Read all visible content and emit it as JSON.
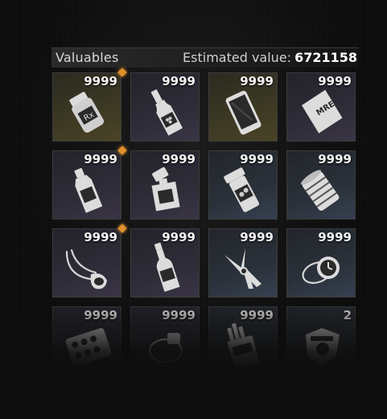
{
  "header": {
    "title": "Valuables",
    "estimate_label": "Estimated value:",
    "estimate_value": "6721158"
  },
  "slots": [
    {
      "count": "9999",
      "icon": "pill-bottle-rx-icon",
      "tint": "gold"
    },
    {
      "count": "9999",
      "icon": "wine-bottle-icon",
      "tint": "purple"
    },
    {
      "count": "9999",
      "icon": "smartphone-icon",
      "tint": "gold"
    },
    {
      "count": "9999",
      "icon": "mre-ration-icon",
      "tint": "purple"
    },
    {
      "count": "9999",
      "icon": "liquor-bottle-icon",
      "tint": "purple"
    },
    {
      "count": "9999",
      "icon": "perfume-bottle-icon",
      "tint": "purple"
    },
    {
      "count": "9999",
      "icon": "medicine-jar-icon",
      "tint": "blue"
    },
    {
      "count": "9999",
      "icon": "tin-can-icon",
      "tint": "blue"
    },
    {
      "count": "9999",
      "icon": "necklace-icon",
      "tint": "purple"
    },
    {
      "count": "9999",
      "icon": "beer-bottle-icon",
      "tint": "purple"
    },
    {
      "count": "9999",
      "icon": "multitool-icon",
      "tint": "blue"
    },
    {
      "count": "9999",
      "icon": "wristwatch-icon",
      "tint": "blue"
    },
    {
      "count": "9999",
      "icon": "pill-blister-icon",
      "tint": "purple"
    },
    {
      "count": "9999",
      "icon": "ring-icon",
      "tint": "purple"
    },
    {
      "count": "9999",
      "icon": "cigarette-pack-icon",
      "tint": "blue"
    },
    {
      "count": "2",
      "icon": "police-badge-icon",
      "tint": "blue"
    }
  ],
  "accent_color": "#e0902a"
}
